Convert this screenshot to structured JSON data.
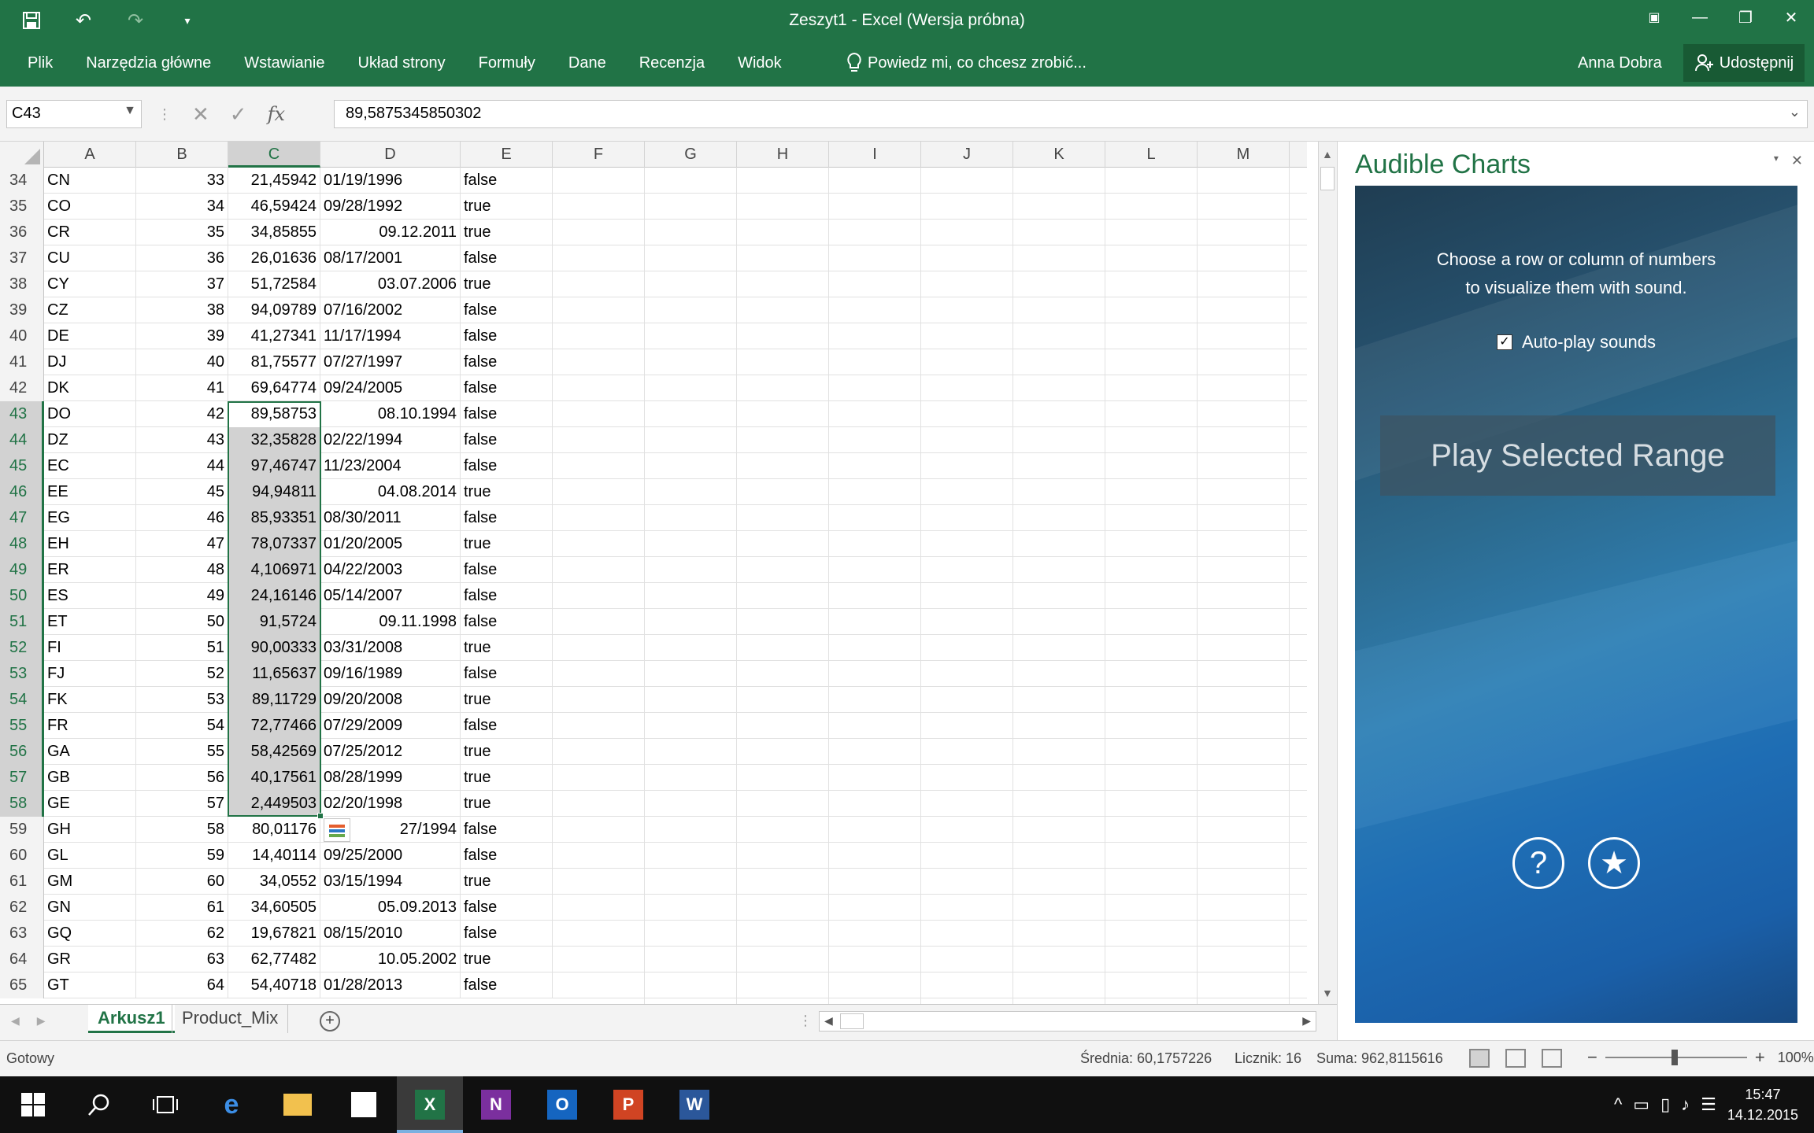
{
  "window": {
    "title": "Zeszyt1 - Excel (Wersja próbna)"
  },
  "ribbon": {
    "tabs": [
      "Plik",
      "Narzędzia główne",
      "Wstawianie",
      "Układ strony",
      "Formuły",
      "Dane",
      "Recenzja",
      "Widok"
    ],
    "tell_me": "Powiedz mi, co chcesz zrobić...",
    "user": "Anna Dobra",
    "share": "Udostępnij"
  },
  "formula_bar": {
    "name_box": "C43",
    "value": "89,5875345850302"
  },
  "columns": [
    "A",
    "B",
    "C",
    "D",
    "E",
    "F",
    "G",
    "H",
    "I",
    "J",
    "K",
    "L",
    "M"
  ],
  "selected_column": "C",
  "rows": [
    {
      "n": "34",
      "a": "CN",
      "b": "33",
      "c": "21,45942",
      "d": "01/19/1996",
      "d_align": "left",
      "e": "false"
    },
    {
      "n": "35",
      "a": "CO",
      "b": "34",
      "c": "46,59424",
      "d": "09/28/1992",
      "d_align": "left",
      "e": "true"
    },
    {
      "n": "36",
      "a": "CR",
      "b": "35",
      "c": "34,85855",
      "d": "09.12.2011",
      "d_align": "right",
      "e": "true"
    },
    {
      "n": "37",
      "a": "CU",
      "b": "36",
      "c": "26,01636",
      "d": "08/17/2001",
      "d_align": "left",
      "e": "false"
    },
    {
      "n": "38",
      "a": "CY",
      "b": "37",
      "c": "51,72584",
      "d": "03.07.2006",
      "d_align": "right",
      "e": "true"
    },
    {
      "n": "39",
      "a": "CZ",
      "b": "38",
      "c": "94,09789",
      "d": "07/16/2002",
      "d_align": "left",
      "e": "false"
    },
    {
      "n": "40",
      "a": "DE",
      "b": "39",
      "c": "41,27341",
      "d": "11/17/1994",
      "d_align": "left",
      "e": "false"
    },
    {
      "n": "41",
      "a": "DJ",
      "b": "40",
      "c": "81,75577",
      "d": "07/27/1997",
      "d_align": "left",
      "e": "false"
    },
    {
      "n": "42",
      "a": "DK",
      "b": "41",
      "c": "69,64774",
      "d": "09/24/2005",
      "d_align": "left",
      "e": "false"
    },
    {
      "n": "43",
      "a": "DO",
      "b": "42",
      "c": "89,58753",
      "d": "08.10.1994",
      "d_align": "right",
      "e": "false"
    },
    {
      "n": "44",
      "a": "DZ",
      "b": "43",
      "c": "32,35828",
      "d": "02/22/1994",
      "d_align": "left",
      "e": "false"
    },
    {
      "n": "45",
      "a": "EC",
      "b": "44",
      "c": "97,46747",
      "d": "11/23/2004",
      "d_align": "left",
      "e": "false"
    },
    {
      "n": "46",
      "a": "EE",
      "b": "45",
      "c": "94,94811",
      "d": "04.08.2014",
      "d_align": "right",
      "e": "true"
    },
    {
      "n": "47",
      "a": "EG",
      "b": "46",
      "c": "85,93351",
      "d": "08/30/2011",
      "d_align": "left",
      "e": "false"
    },
    {
      "n": "48",
      "a": "EH",
      "b": "47",
      "c": "78,07337",
      "d": "01/20/2005",
      "d_align": "left",
      "e": "true"
    },
    {
      "n": "49",
      "a": "ER",
      "b": "48",
      "c": "4,106971",
      "d": "04/22/2003",
      "d_align": "left",
      "e": "false"
    },
    {
      "n": "50",
      "a": "ES",
      "b": "49",
      "c": "24,16146",
      "d": "05/14/2007",
      "d_align": "left",
      "e": "false"
    },
    {
      "n": "51",
      "a": "ET",
      "b": "50",
      "c": "91,5724",
      "d": "09.11.1998",
      "d_align": "right",
      "e": "false"
    },
    {
      "n": "52",
      "a": "FI",
      "b": "51",
      "c": "90,00333",
      "d": "03/31/2008",
      "d_align": "left",
      "e": "true"
    },
    {
      "n": "53",
      "a": "FJ",
      "b": "52",
      "c": "11,65637",
      "d": "09/16/1989",
      "d_align": "left",
      "e": "false"
    },
    {
      "n": "54",
      "a": "FK",
      "b": "53",
      "c": "89,11729",
      "d": "09/20/2008",
      "d_align": "left",
      "e": "true"
    },
    {
      "n": "55",
      "a": "FR",
      "b": "54",
      "c": "72,77466",
      "d": "07/29/2009",
      "d_align": "left",
      "e": "false"
    },
    {
      "n": "56",
      "a": "GA",
      "b": "55",
      "c": "58,42569",
      "d": "07/25/2012",
      "d_align": "left",
      "e": "true"
    },
    {
      "n": "57",
      "a": "GB",
      "b": "56",
      "c": "40,17561",
      "d": "08/28/1999",
      "d_align": "left",
      "e": "true"
    },
    {
      "n": "58",
      "a": "GE",
      "b": "57",
      "c": "2,449503",
      "d": "02/20/1998",
      "d_align": "left",
      "e": "true"
    },
    {
      "n": "59",
      "a": "GH",
      "b": "58",
      "c": "80,01176",
      "d": "27/1994",
      "d_align": "right",
      "e": "false"
    },
    {
      "n": "60",
      "a": "GL",
      "b": "59",
      "c": "14,40114",
      "d": "09/25/2000",
      "d_align": "left",
      "e": "false"
    },
    {
      "n": "61",
      "a": "GM",
      "b": "60",
      "c": "34,0552",
      "d": "03/15/1994",
      "d_align": "left",
      "e": "true"
    },
    {
      "n": "62",
      "a": "GN",
      "b": "61",
      "c": "34,60505",
      "d": "05.09.2013",
      "d_align": "right",
      "e": "false"
    },
    {
      "n": "63",
      "a": "GQ",
      "b": "62",
      "c": "19,67821",
      "d": "08/15/2010",
      "d_align": "left",
      "e": "false"
    },
    {
      "n": "64",
      "a": "GR",
      "b": "63",
      "c": "62,77482",
      "d": "10.05.2002",
      "d_align": "right",
      "e": "true"
    },
    {
      "n": "65",
      "a": "GT",
      "b": "64",
      "c": "54,40718",
      "d": "01/28/2013",
      "d_align": "left",
      "e": "false"
    }
  ],
  "selection": {
    "first_row": "43",
    "last_row": "58",
    "active_row": "43"
  },
  "sheets": {
    "active": "Arkusz1",
    "other": "Product_Mix"
  },
  "task_pane": {
    "title": "Audible Charts",
    "instruction_line1": "Choose a row or column of numbers",
    "instruction_line2": "to visualize them with sound.",
    "autoplay_label": "Auto-play sounds",
    "autoplay_checked": true,
    "play_button": "Play Selected Range",
    "help_glyph": "?",
    "star_glyph": "★"
  },
  "status_bar": {
    "ready": "Gotowy",
    "average": "Średnia: 60,1757226",
    "count": "Licznik: 16",
    "sum": "Suma: 962,8115616",
    "zoom": "100%"
  },
  "taskbar": {
    "time": "15:47",
    "date": "14.12.2015",
    "icons": [
      "windows-start-icon",
      "search-icon",
      "task-view-icon",
      "edge-icon",
      "file-explorer-icon",
      "store-icon",
      "excel-icon",
      "onenote-icon",
      "outlook-icon",
      "powerpoint-icon",
      "word-icon"
    ]
  },
  "colors": {
    "excel_green": "#217346",
    "selection_gray": "#d2d2d2"
  }
}
